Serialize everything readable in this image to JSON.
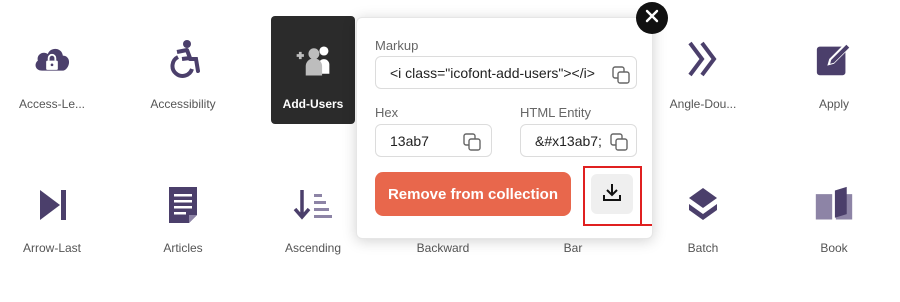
{
  "grid": {
    "row1": [
      {
        "label": "Access-Le...",
        "icon": "cloud-lock-icon"
      },
      {
        "label": "Accessibility",
        "icon": "wheelchair-icon"
      },
      {
        "label": "Add-Users",
        "icon": "add-users-icon",
        "selected": true
      },
      {
        "label": "Angle-Dou...",
        "icon": "angle-double-right-icon"
      },
      {
        "label": "Apply",
        "icon": "apply-edit-icon"
      }
    ],
    "row2": [
      {
        "label": "Arrow-Last",
        "icon": "arrow-last-icon"
      },
      {
        "label": "Articles",
        "icon": "articles-icon"
      },
      {
        "label": "Ascending",
        "icon": "ascending-icon"
      },
      {
        "label": "Backward",
        "icon": "backward-icon"
      },
      {
        "label": "Bar",
        "icon": "bar-icon"
      },
      {
        "label": "Batch",
        "icon": "batch-icon"
      },
      {
        "label": "Book",
        "icon": "book-icon"
      }
    ]
  },
  "popup": {
    "markup_label": "Markup",
    "markup_value": "<i class=\"icofont-add-users\"></i>",
    "hex_label": "Hex",
    "hex_value": "13ab7",
    "entity_label": "HTML Entity",
    "entity_value": "&#x13ab7;",
    "remove_label": "Remove from collection"
  },
  "colors": {
    "icon": "#4b3f6b",
    "selected_bg": "#2b2b2b",
    "accent": "#e8674c",
    "highlight": "#e02020"
  }
}
